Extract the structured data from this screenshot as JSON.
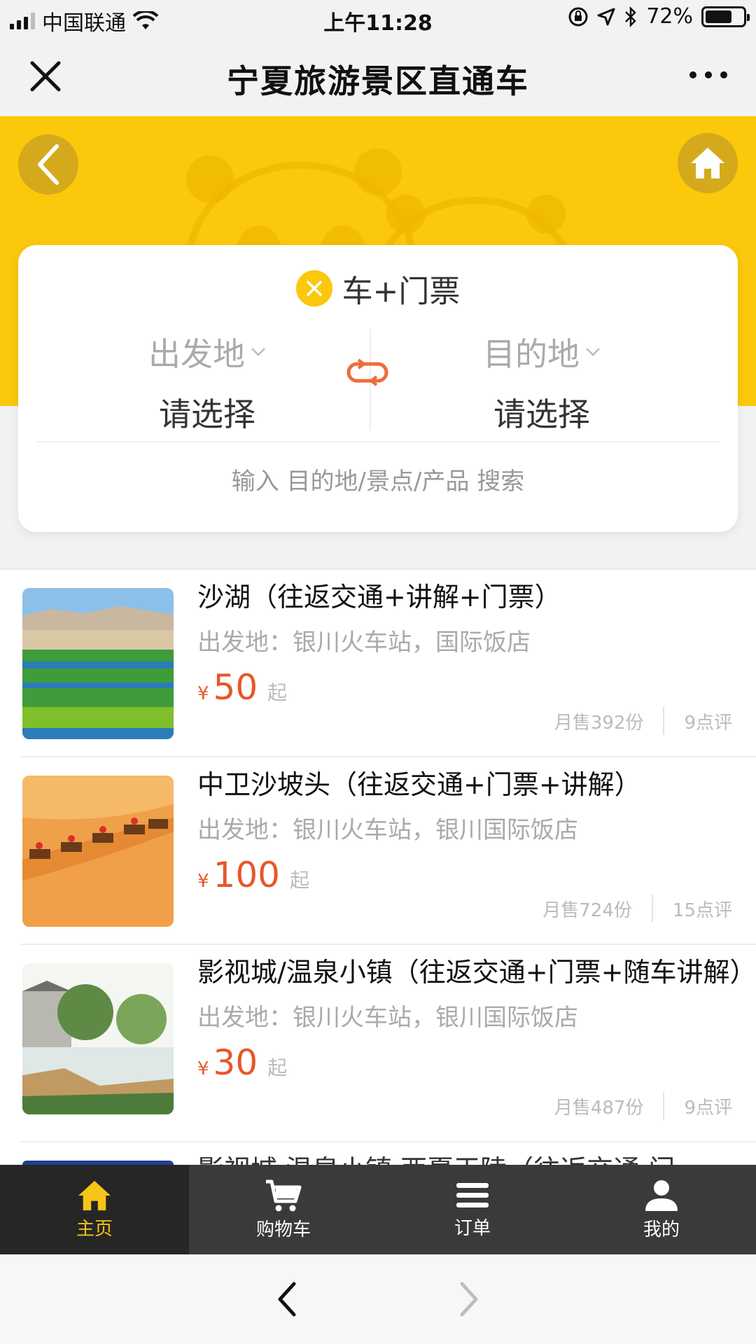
{
  "status": {
    "carrier": "中国联通",
    "time": "上午11:28",
    "battery": "72%",
    "battery_level": 0.72
  },
  "nav": {
    "title": "宁夏旅游景区直通车",
    "close_icon": "close-icon",
    "more_icon": "more-icon"
  },
  "banner": {
    "back_icon": "back-arrow-icon",
    "home_icon": "home-icon",
    "accent": "#fbc80c"
  },
  "search": {
    "tab_label": "车+门票",
    "from_label": "出发地",
    "from_value": "请选择",
    "to_label": "目的地",
    "to_value": "请选择",
    "swap_icon": "swap-icon",
    "hint": "输入 目的地/景点/产品 搜索"
  },
  "products": [
    {
      "name": "沙湖（往返交通+讲解+门票）",
      "depart": "出发地：银川火车站，国际饭店",
      "currency": "¥",
      "price": "50",
      "from_suffix": "起",
      "sales": "月售392份",
      "reviews": "9点评"
    },
    {
      "name": "中卫沙坡头（往返交通+门票+讲解）",
      "depart": "出发地：银川火车站，银川国际饭店",
      "currency": "¥",
      "price": "100",
      "from_suffix": "起",
      "sales": "月售724份",
      "reviews": "15点评"
    },
    {
      "name": "影视城/温泉小镇（往返交通+门票+随车讲解）",
      "depart": "出发地：银川火车站，银川国际饭店",
      "currency": "¥",
      "price": "30",
      "from_suffix": "起",
      "sales": "月售487份",
      "reviews": "9点评"
    },
    {
      "name": "影视城 温泉小镇 西夏王陵（往返交通 门"
    }
  ],
  "tabbar": [
    {
      "label": "主页",
      "icon": "home-icon",
      "active": true
    },
    {
      "label": "购物车",
      "icon": "cart-icon",
      "active": false
    },
    {
      "label": "订单",
      "icon": "menu-icon",
      "active": false
    },
    {
      "label": "我的",
      "icon": "user-icon",
      "active": false
    }
  ],
  "browser": {
    "back_icon": "chevron-left-icon",
    "forward_icon": "chevron-right-icon"
  }
}
